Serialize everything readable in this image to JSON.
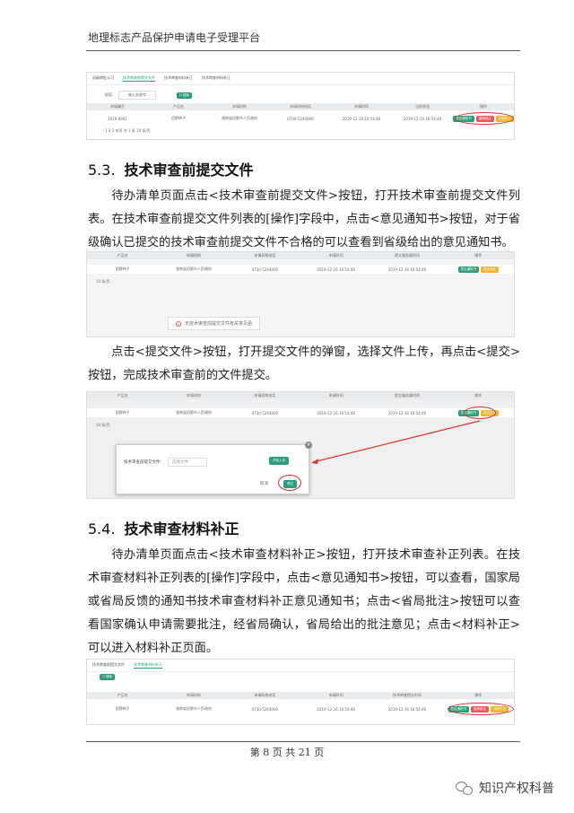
{
  "header": {
    "title": "地理标志产品保护申请电子受理平台"
  },
  "screenshot1": {
    "tabs": [
      "初级审批认可",
      "技术审查前提交文件",
      "技术审查材料补正",
      "技术审查材料补正"
    ],
    "search_label": "搜索：",
    "search_placeholder": "输入关键字",
    "search_button": "Q 搜索",
    "columns": [
      "申请编号",
      "产品名",
      "申请机构",
      "申请机构电话",
      "申请时间",
      "当前状态",
      "操作"
    ],
    "row": [
      "2019-0001",
      "田野柿子",
      "湖南省田野市人民政府",
      "0730-5244000",
      "2019-12-16 16:54:46",
      "2019-12-16 16:54:46"
    ],
    "buttons": [
      "意见通知书",
      "省局批注",
      "材料补正"
    ],
    "pager": "1  2  3  末页  共 1 条  10 条/页"
  },
  "section1": {
    "number": "5.3.",
    "title": "技术审查前提交文件",
    "paragraph": "待办清单页面点击<技术审查前提交文件>按钮，打开技术审查前提交文件列表。在技术审查前提交文件列表的[操作]字段中，点击<意见通知书>按钮，对于省级确认已提交的技术审查前提交文件不合格的可以查看到省级给出的意见通知书。"
  },
  "screenshot2": {
    "columns": [
      "产品名",
      "申请机构",
      "申请机构电话",
      "申请时间",
      "提交服务器时间",
      "操作"
    ],
    "row": [
      "田野柿子",
      "湖南省田野市人民政府",
      "0730-5244000",
      "2019-12-16 16:54:46",
      "2019-12-16 16:54:46"
    ],
    "buttons": [
      "意见通知书",
      "提交文件"
    ],
    "per_page": "10 条/页",
    "error_msg": "无技术审查前提交文件有关意见函"
  },
  "paragraph2": "点击<提交文件>按钮，打开提交文件的弹窗，选择文件上传，再点击<提交>按钮，完成技术审查前的文件提交。",
  "screenshot3": {
    "columns": [
      "产品名",
      "申请机构",
      "申请机构电话",
      "申请时间",
      "提交服务器时间",
      "操作"
    ],
    "row": [
      "田野柿子",
      "湖南省田野市人民政府",
      "0730-5244000",
      "2019-12-16 16:54:46",
      "2019-12-16 16:54:46"
    ],
    "buttons": [
      "意见通知书",
      "提交文件"
    ],
    "per_page": "10 条/页",
    "modal_label": "技术审查前提交文件：",
    "modal_input": "选择文件",
    "modal_upload": "开始上传",
    "modal_cancel": "取消",
    "modal_submit": "提交"
  },
  "section2": {
    "number": "5.4.",
    "title": "技术审查材料补正",
    "paragraph": "待办清单页面点击<技术审查材料补正>按钮，打开技术审查补正列表。在技术审查材料补正列表的[操作]字段中，点击<意见通知书>按钮，可以查看，国家局或省局反馈的通知书技术审查材料补正意见通知书；点击<省局批注>按钮可以查看国家确认申请需要批注，经省局确认，省局给出的批注意见；点击<材料补正>可以进入材料补正页面。"
  },
  "screenshot4": {
    "tabs": [
      "技术审查前提交文件",
      "技术审查材料补正"
    ],
    "search_button": "Q 搜索",
    "columns": [
      "产品名",
      "申请机构",
      "申请机构电话",
      "申请时间",
      "技术审查提交时间",
      "操作"
    ],
    "row": [
      "田野柿子",
      "湖南省田野市人民政府",
      "0730-5244000",
      "2019-12-16 16:54:46",
      "2019-12-16 16:54:46"
    ],
    "buttons": [
      "意见通知书",
      "省局批注",
      "材料补正"
    ]
  },
  "footer": {
    "page": "第 8 页  共 21 页"
  },
  "watermark": {
    "text": "知识产权科普"
  }
}
